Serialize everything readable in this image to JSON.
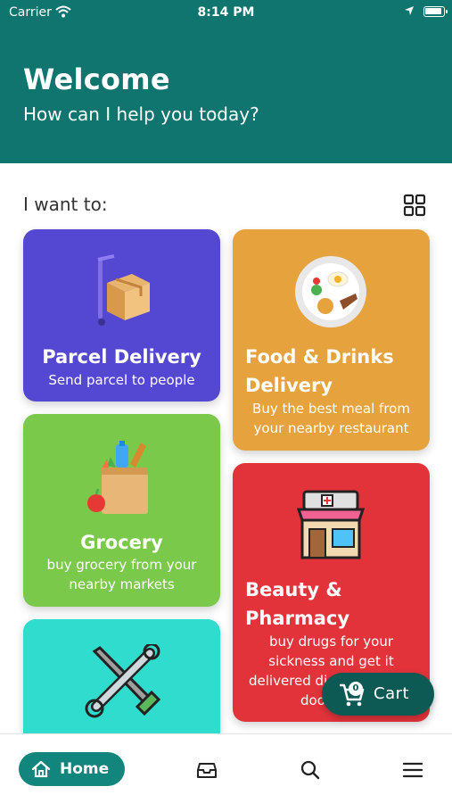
{
  "status_bar": {
    "carrier": "Carrier",
    "time": "8:14 PM"
  },
  "header": {
    "title": "Welcome",
    "subtitle": "How can I help you today?"
  },
  "section": {
    "title": "I want to:"
  },
  "cards": {
    "parcel": {
      "title": "Parcel Delivery",
      "desc": "Send parcel to people",
      "color": "#5447d1",
      "icon": "parcel-box-icon"
    },
    "food": {
      "title_line1": "Food & Drinks",
      "title_line2": "Delivery",
      "desc_line1": "Buy the best meal from",
      "desc_line2": "your nearby restaurant",
      "color": "#e6a23c",
      "icon": "meal-plate-icon"
    },
    "grocery": {
      "title": "Grocery",
      "desc_line1": "buy grocery from your",
      "desc_line2": "nearby markets",
      "color": "#7ac94b",
      "icon": "grocery-bag-icon"
    },
    "pharmacy": {
      "title_line1": "Beauty &",
      "title_line2": "Pharmacy",
      "desc_line1": "buy drugs for your",
      "desc_line2": "sickness and get it",
      "desc_line3": "delivered di",
      "desc_line4": "doo",
      "color": "#e2333b",
      "icon": "pharmacy-store-icon"
    },
    "tools": {
      "color": "#2fdccd",
      "icon": "tools-icon"
    }
  },
  "cart": {
    "count": "0",
    "label": "Cart"
  },
  "bottom_nav": {
    "home_label": "Home"
  },
  "colors": {
    "header": "#0f756e",
    "accent": "#12867d",
    "cart": "#0d5a55"
  }
}
